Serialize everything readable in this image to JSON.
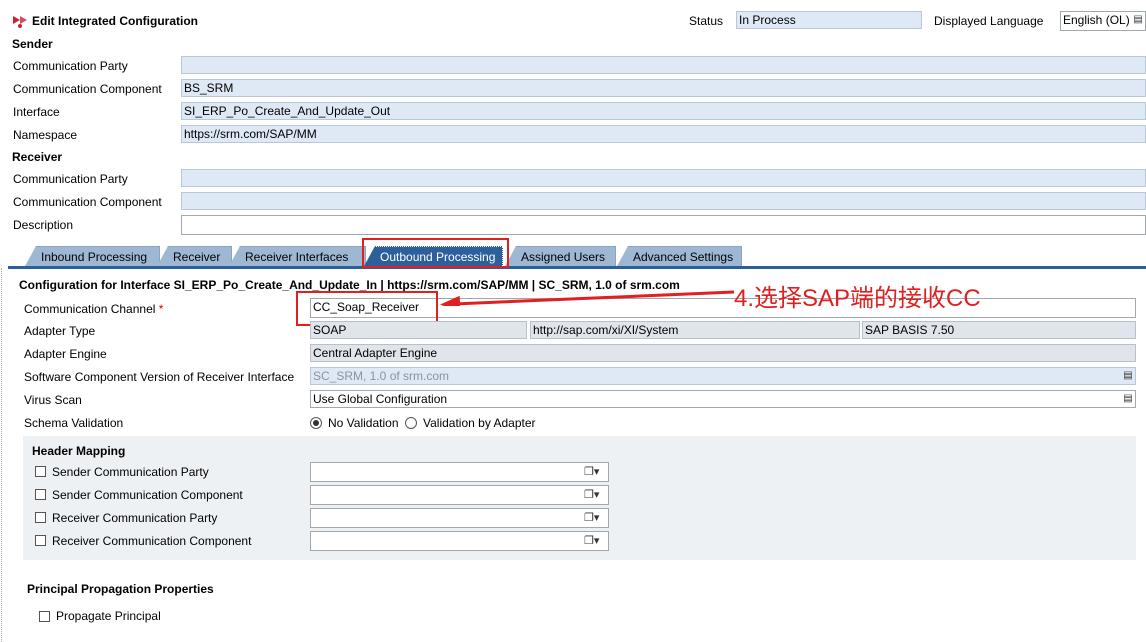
{
  "header": {
    "title": "Edit Integrated Configuration",
    "status_label": "Status",
    "status_value": "In Process",
    "language_label": "Displayed Language",
    "language_value": "English (OL)"
  },
  "sender": {
    "section": "Sender",
    "comm_party_label": "Communication Party",
    "comm_party_value": "",
    "comm_component_label": "Communication Component",
    "comm_component_value": "BS_SRM",
    "interface_label": "Interface",
    "interface_value": "SI_ERP_Po_Create_And_Update_Out",
    "namespace_label": "Namespace",
    "namespace_value": "https://srm.com/SAP/MM"
  },
  "receiver": {
    "section": "Receiver",
    "comm_party_label": "Communication Party",
    "comm_party_value": "",
    "comm_component_label": "Communication Component",
    "comm_component_value": "",
    "description_label": "Description",
    "description_value": ""
  },
  "tabs": [
    {
      "label": "Inbound Processing"
    },
    {
      "label": "Receiver"
    },
    {
      "label": "Receiver Interfaces"
    },
    {
      "label": "Outbound Processing"
    },
    {
      "label": "Assigned Users"
    },
    {
      "label": "Advanced Settings"
    }
  ],
  "outbound": {
    "config_title": "Configuration for Interface SI_ERP_Po_Create_And_Update_In | https://srm.com/SAP/MM | SC_SRM, 1.0 of srm.com",
    "comm_channel_label": "Communication Channel",
    "required_mark": "*",
    "comm_channel_value": "CC_Soap_Receiver",
    "annotation": "4.选择SAP端的接收CC",
    "adapter_type_label": "Adapter Type",
    "adapter_type_value": "SOAP",
    "adapter_namespace": "http://sap.com/xi/XI/System",
    "adapter_swc": "SAP BASIS 7.50",
    "adapter_engine_label": "Adapter Engine",
    "adapter_engine_value": "Central Adapter Engine",
    "swcv_label": "Software Component Version of Receiver Interface",
    "swcv_value": "SC_SRM, 1.0 of srm.com",
    "virus_scan_label": "Virus Scan",
    "virus_scan_value": "Use Global Configuration",
    "schema_label": "Schema Validation",
    "schema_opt1": "No Validation",
    "schema_opt2": "Validation by Adapter"
  },
  "header_mapping": {
    "title": "Header Mapping",
    "rows": [
      {
        "label": "Sender Communication Party",
        "value": ""
      },
      {
        "label": "Sender Communication Component",
        "value": ""
      },
      {
        "label": "Receiver Communication Party",
        "value": ""
      },
      {
        "label": "Receiver Communication Component",
        "value": ""
      }
    ]
  },
  "principal": {
    "title": "Principal Propagation Properties",
    "checkbox_label": "Propagate Principal"
  },
  "colors": {
    "field_bg": "#dfe9f5",
    "tab_bg": "#9eb8d3",
    "tab_active": "#2d5f9a",
    "annotation_red": "#e02020"
  }
}
